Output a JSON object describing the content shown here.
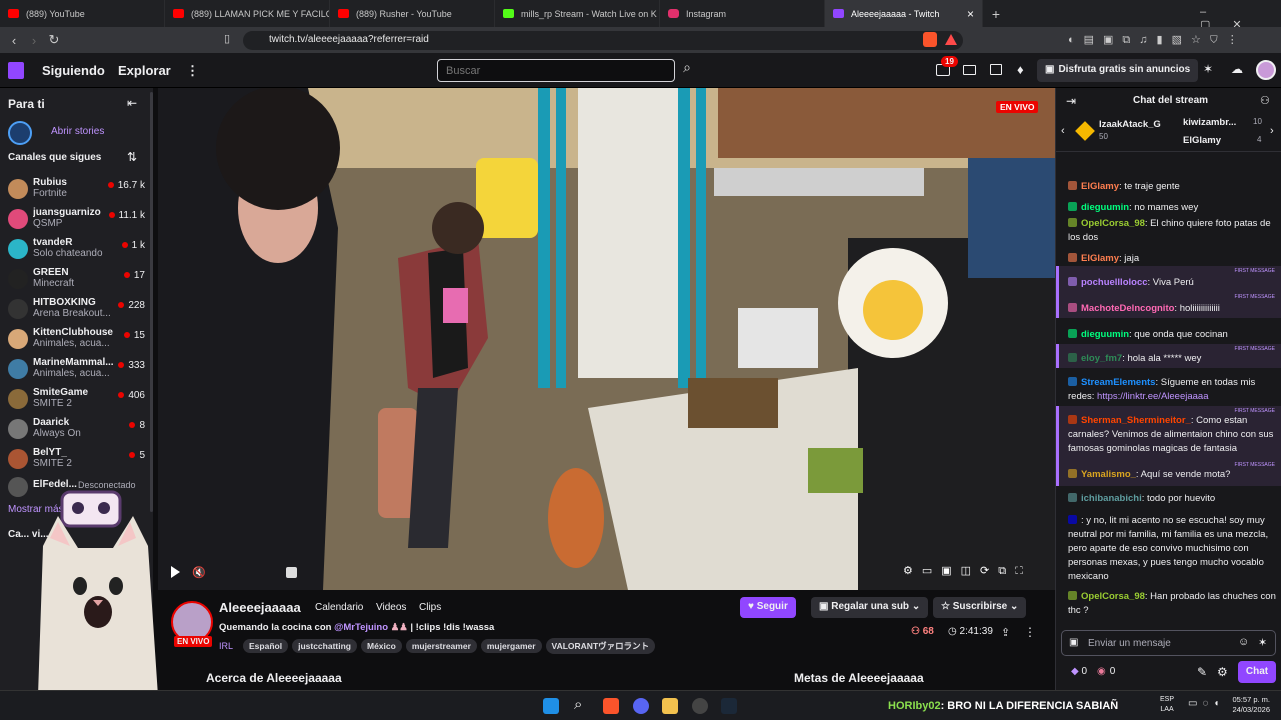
{
  "browser": {
    "tabs": [
      {
        "label": "(889) YouTube",
        "color": "#ff0000"
      },
      {
        "label": "(889) LLAMAN PICK ME Y FACILOTA A",
        "color": "#ff0000"
      },
      {
        "label": "(889) Rusher - YouTube",
        "color": "#ff0000"
      },
      {
        "label": "mills_rp Stream - Watch Live on K",
        "color": "#53fc18"
      },
      {
        "label": "Instagram",
        "color": "#e1306c"
      },
      {
        "label": "Aleeeejaaaaa - Twitch",
        "color": "#9146ff"
      }
    ],
    "close_glyph": "×",
    "new_tab": "+",
    "url": "twitch.tv/aleeeejaaaaa?referrer=raid"
  },
  "nav": {
    "following": "Siguiendo",
    "browse": "Explorar",
    "more": "⋮",
    "search_placeholder": "Buscar",
    "notif_count": "19",
    "ad_free": "Disfruta gratis sin anuncios"
  },
  "sidebar": {
    "for_you": "Para ti",
    "open_stories": "Abrir stories",
    "followed_title": "Canales que sigues",
    "channels": [
      {
        "name": "Rubius",
        "game": "Fortnite",
        "viewers": "16.7 k",
        "color": "#c28b5a"
      },
      {
        "name": "juansguarnizo",
        "game": "QSMP",
        "viewers": "11.1 k",
        "color": "#e04a7a"
      },
      {
        "name": "tvandeR",
        "game": "Solo chateando",
        "viewers": "1 k",
        "color": "#2bb5c8"
      },
      {
        "name": "GREEN",
        "game": "Minecraft",
        "viewers": "17",
        "color": "#222222"
      },
      {
        "name": "HITBOXKING",
        "game": "Arena Breakout...",
        "viewers": "228",
        "color": "#333333"
      },
      {
        "name": "KittenClubhouse",
        "game": "Animales, acua...",
        "viewers": "15",
        "color": "#d8a878"
      },
      {
        "name": "MarineMammal...",
        "game": "Animales, acua...",
        "viewers": "333",
        "color": "#3f7ca5"
      },
      {
        "name": "SmiteGame",
        "game": "SMITE 2",
        "viewers": "406",
        "color": "#8a6a3a"
      },
      {
        "name": "Daarick",
        "game": "Always On",
        "viewers": "8",
        "color": "#777777"
      },
      {
        "name": "BelYT_",
        "game": "SMITE 2",
        "viewers": "5",
        "color": "#aa5533"
      }
    ],
    "offline_name": "ElFedel...",
    "offline_status": "Desconectado",
    "show_more": "Mostrar más",
    "also_watching": "Ca... vi..."
  },
  "player": {
    "live_badge": "EN VIVO"
  },
  "stream": {
    "channel": "Aleeeejaaaaa",
    "tab_calendar": "Calendario",
    "tab_videos": "Videos",
    "tab_clips": "Clips",
    "title": "Quemando la cocina con",
    "mention": "@MrTejuino",
    "title_tail": "| !clips !dis !wassa",
    "category": "IRL",
    "tags": [
      "Español",
      "justcchatting",
      "México",
      "mujerstreamer",
      "mujergamer",
      "VALORANTヴァロラント"
    ],
    "follow": "Seguir",
    "gift_sub": "Regalar una sub",
    "subscribe": "Suscribirse",
    "viewers": "68",
    "uptime": "2:41:39",
    "live": "EN VIVO",
    "about": "Acerca de Aleeeejaaaaa",
    "goals": "Metas de Aleeeejaaaaa"
  },
  "chat": {
    "header": "Chat del stream",
    "leader1": "IzaakAtack_G",
    "leader1_pts": "50",
    "leader2": "kiwizambr...",
    "leader2_pts": "10",
    "leader3": "ElGlamy",
    "leader3_pts": "4",
    "first_msg": "FIRST MESSAGE",
    "messages": [
      {
        "user": "ElGlamy",
        "color": "#ff7f50",
        "text": ": te traje gente"
      },
      {
        "user": "dieguumin",
        "color": "#00ff7f",
        "text": ": no mames wey"
      },
      {
        "user": "OpelCorsa_98",
        "color": "#9acd32",
        "text": ": El chino quiere foto patas de los dos"
      },
      {
        "user": "ElGlamy",
        "color": "#ff7f50",
        "text": ": jaja"
      },
      {
        "user": "pochuelllolocc",
        "color": "#b983ff",
        "text": ": Viva Perú"
      },
      {
        "user": "MachoteDelncognito",
        "color": "#ff69b4",
        "text": ": holiiiiiiiiiiiii"
      },
      {
        "user": "dieguumin",
        "color": "#00ff7f",
        "text": ": que onda que cocinan"
      },
      {
        "user": "eloy_fm7",
        "color": "#2e8b57",
        "text": ": hola ala ***** wey"
      },
      {
        "user": "StreamElements",
        "color": "#1e90ff",
        "text": ": Sígueme en todas mis redes: ",
        "link": "https://linktr.ee/Aleeejaaaa"
      },
      {
        "user": "Sherman_Shermineitor_",
        "color": "#ff4500",
        "text": ": Como estan carnales? Venimos de alimentaion chino con sus famosas gominolas magicas de fantasia"
      },
      {
        "user": "Yamalismo_",
        "color": "#daa520",
        "text": ": Aquí se vende mota?"
      },
      {
        "user": "ichibanabichi",
        "color": "#5f9ea0",
        "text": ": todo por huevito"
      },
      {
        "user": "",
        "color": "#0000ff",
        "text": ": y no, lit mi acento no se escucha! soy muy neutral por mi familia, mi familia es una mezcla, pero aparte de eso convivo muchisimo con personas mexas, y pues tengo mucho vocablo mexicano"
      },
      {
        "user": "OpelCorsa_98",
        "color": "#9acd32",
        "text": ": Han probado las chuches con thc ?"
      }
    ],
    "input_placeholder": "Enviar un mensaje",
    "points1": "0",
    "points2": "0",
    "send": "Chat"
  },
  "taskbar": {
    "ticker_user": "HORIby02",
    "ticker_text": ": BRO NI LA DIFERENCIA SABIAÑ",
    "lang": "ESP",
    "lang2": "LAA",
    "time": "05:57 p. m.",
    "date": "24/03/2026"
  }
}
